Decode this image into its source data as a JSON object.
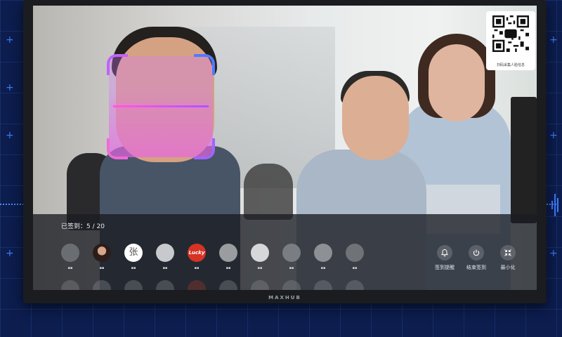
{
  "device": {
    "brand": "MAXHUB"
  },
  "qr": {
    "label": "扫码采集人脸信息",
    "icon": "qr-code-icon"
  },
  "checkin": {
    "count_text": "已签到：5 / 20"
  },
  "avatars": [
    {
      "icon": "user-avatar-icon"
    },
    {
      "icon": "user-avatar-icon"
    },
    {
      "text": "张"
    },
    {
      "icon": "user-avatar-icon"
    },
    {
      "text": "Lucky"
    },
    {
      "icon": "user-avatar-icon"
    },
    {
      "icon": "user-avatar-icon"
    },
    {
      "icon": "user-avatar-icon"
    },
    {
      "icon": "user-avatar-icon"
    },
    {
      "icon": "user-avatar-icon"
    }
  ],
  "controls": {
    "remind": {
      "label": "签到提醒",
      "icon": "bell-icon"
    },
    "end": {
      "label": "结束签到",
      "icon": "power-icon"
    },
    "minimize": {
      "label": "最小化",
      "icon": "collapse-icon"
    }
  },
  "colors": {
    "backdrop": "#0c1d4e",
    "accent": "#3d7bff",
    "face_frame": "#c163f7",
    "panel": "#1a1c22"
  }
}
